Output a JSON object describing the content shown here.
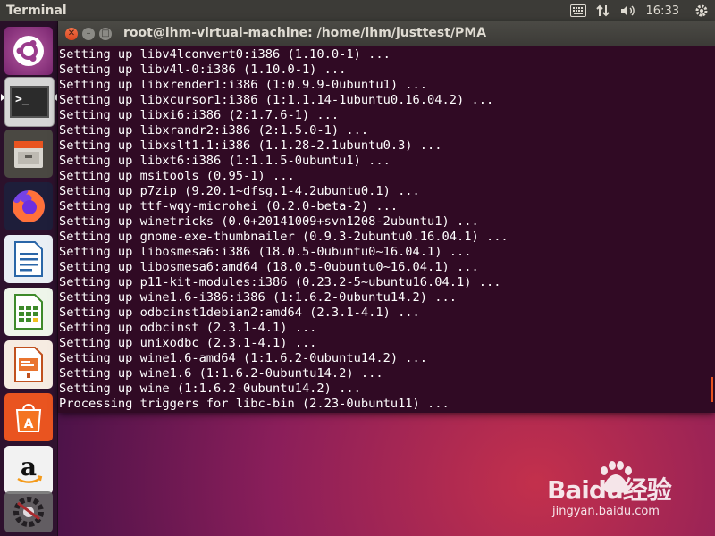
{
  "top_panel": {
    "app_title": "Terminal",
    "clock": "16:33",
    "indicator_icons": [
      "keyboard-icon",
      "network-updown-icon",
      "volume-icon",
      "gear-icon"
    ]
  },
  "launcher": {
    "items": [
      {
        "name": "ubuntu-dash-icon",
        "active": false
      },
      {
        "name": "terminal-app-icon",
        "active": true
      },
      {
        "name": "files-app-icon",
        "active": false
      },
      {
        "name": "firefox-app-icon",
        "active": false
      },
      {
        "name": "libreoffice-writer-icon",
        "active": false
      },
      {
        "name": "libreoffice-calc-icon",
        "active": false
      },
      {
        "name": "libreoffice-impress-icon",
        "active": false
      },
      {
        "name": "ubuntu-software-icon",
        "active": false
      },
      {
        "name": "amazon-app-icon",
        "active": false
      },
      {
        "name": "system-settings-icon",
        "active": false
      }
    ]
  },
  "terminal": {
    "title": "root@lhm-virtual-machine: /home/lhm/justtest/PMA",
    "lines": [
      "Setting up libv4lconvert0:i386 (1.10.0-1) ...",
      "Setting up libv4l-0:i386 (1.10.0-1) ...",
      "Setting up libxrender1:i386 (1:0.9.9-0ubuntu1) ...",
      "Setting up libxcursor1:i386 (1:1.1.14-1ubuntu0.16.04.2) ...",
      "Setting up libxi6:i386 (2:1.7.6-1) ...",
      "Setting up libxrandr2:i386 (2:1.5.0-1) ...",
      "Setting up libxslt1.1:i386 (1.1.28-2.1ubuntu0.3) ...",
      "Setting up libxt6:i386 (1:1.1.5-0ubuntu1) ...",
      "Setting up msitools (0.95-1) ...",
      "Setting up p7zip (9.20.1~dfsg.1-4.2ubuntu0.1) ...",
      "Setting up ttf-wqy-microhei (0.2.0-beta-2) ...",
      "Setting up winetricks (0.0+20141009+svn1208-2ubuntu1) ...",
      "Setting up gnome-exe-thumbnailer (0.9.3-2ubuntu0.16.04.1) ...",
      "Setting up libosmesa6:i386 (18.0.5-0ubuntu0~16.04.1) ...",
      "Setting up libosmesa6:amd64 (18.0.5-0ubuntu0~16.04.1) ...",
      "Setting up p11-kit-modules:i386 (0.23.2-5~ubuntu16.04.1) ...",
      "Setting up wine1.6-i386:i386 (1:1.6.2-0ubuntu14.2) ...",
      "Setting up odbcinst1debian2:amd64 (2.3.1-4.1) ...",
      "Setting up odbcinst (2.3.1-4.1) ...",
      "Setting up unixodbc (2.3.1-4.1) ...",
      "Setting up wine1.6-amd64 (1:1.6.2-0ubuntu14.2) ...",
      "Setting up wine1.6 (1:1.6.2-0ubuntu14.2) ...",
      "Setting up wine (1:1.6.2-0ubuntu14.2) ...",
      "Processing triggers for libc-bin (2.23-0ubuntu11) ..."
    ]
  },
  "watermark": {
    "brand": "Baidu经验",
    "url": "jingyan.baidu.com"
  },
  "colors": {
    "terminal_bg": "#300a24",
    "panel_bg": "#3c3b37",
    "accent": "#e95420"
  }
}
